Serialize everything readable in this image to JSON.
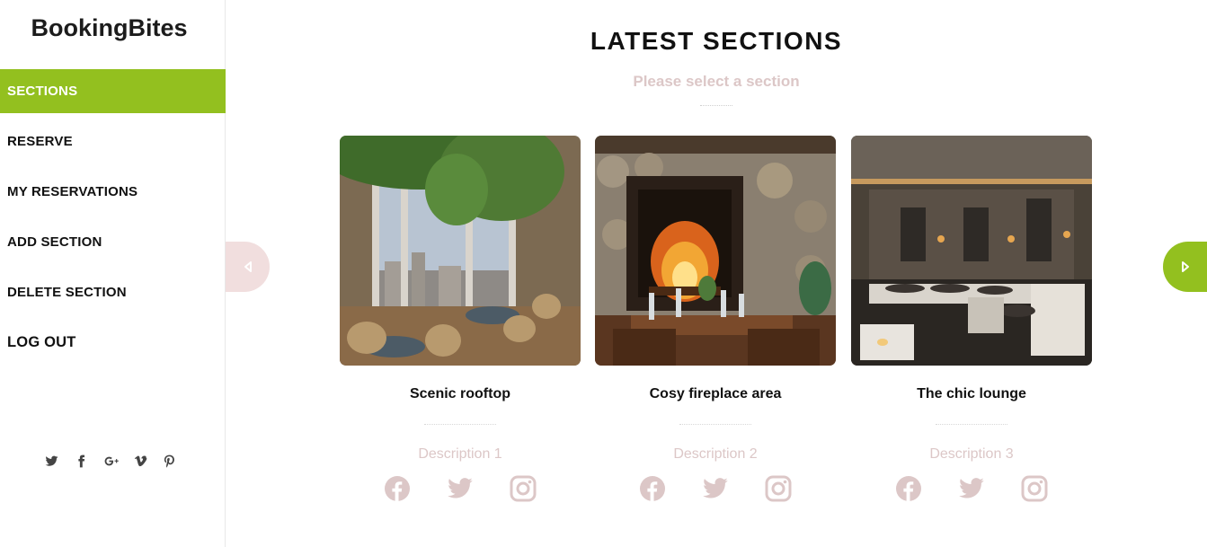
{
  "brand": "BookingBites",
  "nav": [
    {
      "label": "SECTIONS",
      "active": true
    },
    {
      "label": "RESERVE"
    },
    {
      "label": "MY RESERVATIONS"
    },
    {
      "label": "ADD SECTION"
    },
    {
      "label": "DELETE SECTION"
    },
    {
      "label": "LOG OUT"
    }
  ],
  "sidebar_social_icons": [
    "twitter-icon",
    "facebook-icon",
    "google-plus-icon",
    "vimeo-icon",
    "pinterest-icon"
  ],
  "main": {
    "title": "LATEST SECTIONS",
    "subtitle": "Please select a section"
  },
  "sections": [
    {
      "title": "Scenic rooftop",
      "description": "Description 1",
      "image": "rooftop-terrace-photo"
    },
    {
      "title": "Cosy fireplace area",
      "description": "Description 2",
      "image": "fireplace-dining-photo"
    },
    {
      "title": "The chic lounge",
      "description": "Description 3",
      "image": "lounge-interior-photo"
    }
  ],
  "card_social_icons": [
    "facebook-icon",
    "twitter-icon",
    "instagram-icon"
  ],
  "colors": {
    "accent": "#93c01f",
    "muted_pink": "#dcc7c7",
    "arrow_left_bg": "#f1dede"
  }
}
